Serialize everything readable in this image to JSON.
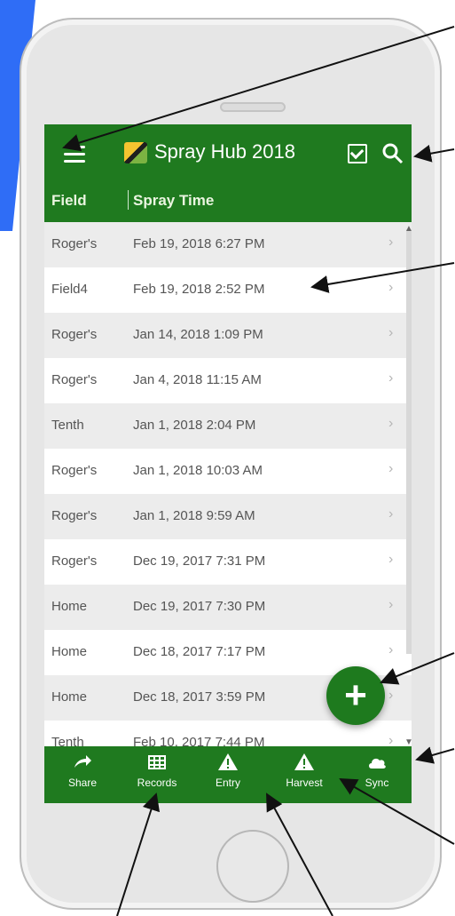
{
  "app": {
    "title": "Spray Hub 2018"
  },
  "columns": {
    "field": "Field",
    "time": "Spray Time"
  },
  "rows": [
    {
      "field": "Roger's",
      "time": "Feb 19, 2018 6:27 PM"
    },
    {
      "field": "Field4",
      "time": "Feb 19, 2018 2:52 PM"
    },
    {
      "field": "Roger's",
      "time": "Jan 14, 2018 1:09 PM"
    },
    {
      "field": "Roger's",
      "time": "Jan 4, 2018 11:15 AM"
    },
    {
      "field": "Tenth",
      "time": "Jan 1, 2018 2:04 PM"
    },
    {
      "field": "Roger's",
      "time": "Jan 1, 2018 10:03 AM"
    },
    {
      "field": "Roger's",
      "time": "Jan 1, 2018 9:59 AM"
    },
    {
      "field": "Roger's",
      "time": "Dec 19, 2017 7:31 PM"
    },
    {
      "field": "Home",
      "time": "Dec 19, 2017 7:30 PM"
    },
    {
      "field": "Home",
      "time": "Dec 18, 2017 7:17 PM"
    },
    {
      "field": "Home",
      "time": "Dec 18, 2017 3:59 PM"
    },
    {
      "field": "Tenth",
      "time": "Feb 10, 2017 7:44 PM"
    }
  ],
  "bottom_nav": {
    "share": "Share",
    "records": "Records",
    "entry": "Entry",
    "harvest": "Harvest",
    "sync": "Sync"
  },
  "colors": {
    "header": "#1f7a1f",
    "fab": "#1e7a1e",
    "accent_blue": "#2f6df6"
  },
  "icons": {
    "menu": "hamburger-icon",
    "search": "search-icon",
    "fab": "plus-icon",
    "share": "share-icon",
    "records": "grid-icon",
    "entry": "warning-icon",
    "harvest": "warning-icon",
    "sync": "cloud-icon"
  }
}
